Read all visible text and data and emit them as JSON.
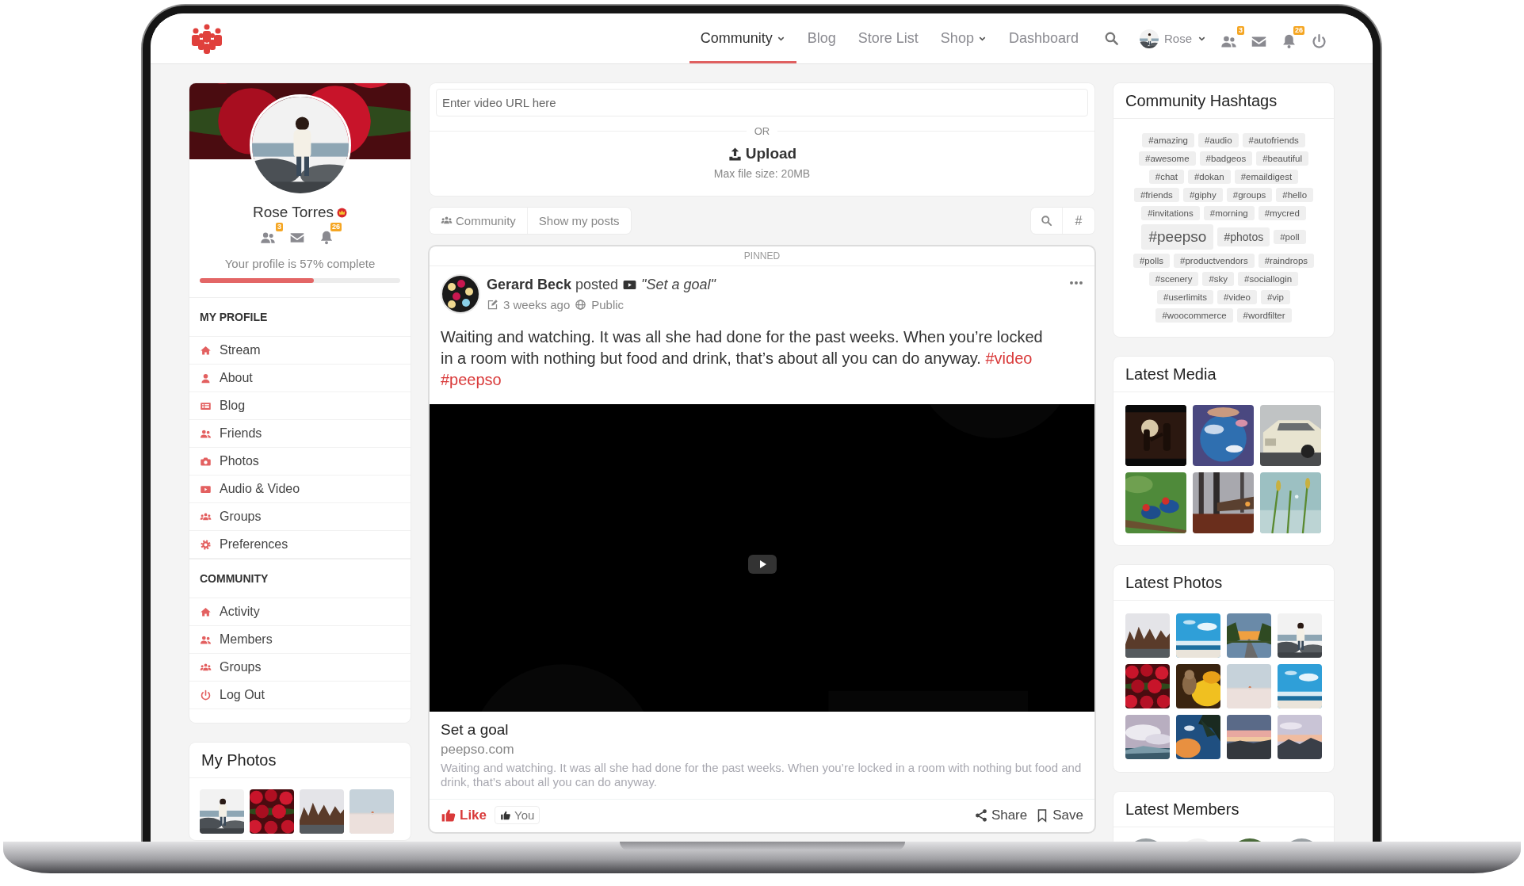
{
  "nav": {
    "items": [
      {
        "label": "Community",
        "selected": true,
        "dropdown": true
      },
      {
        "label": "Blog",
        "selected": false,
        "dropdown": false
      },
      {
        "label": "Store List",
        "selected": false,
        "dropdown": false
      },
      {
        "label": "Shop",
        "selected": false,
        "dropdown": true
      },
      {
        "label": "Dashboard",
        "selected": false,
        "dropdown": false
      }
    ],
    "user": {
      "name": "Rose"
    },
    "notifications": [
      {
        "kind": "friends",
        "badge": "3"
      },
      {
        "kind": "mail"
      },
      {
        "kind": "bell",
        "badge": "26"
      }
    ]
  },
  "profile": {
    "name": "Rose Torres",
    "notifications": [
      {
        "kind": "friends",
        "badge": "3"
      },
      {
        "kind": "mail"
      },
      {
        "kind": "bell",
        "badge": "26"
      }
    ],
    "completion": "Your profile is 57% complete",
    "level": 0.57
  },
  "menu": [
    {
      "title": "MY PROFILE",
      "items": [
        {
          "label": "Stream",
          "kind": "home"
        },
        {
          "label": "About",
          "kind": "user"
        },
        {
          "label": "Blog",
          "kind": "list"
        },
        {
          "label": "Friends",
          "kind": "friends"
        },
        {
          "label": "Photos",
          "kind": "camera"
        },
        {
          "label": "Audio & Video",
          "kind": "video"
        },
        {
          "label": "Groups",
          "kind": "groups"
        },
        {
          "label": "Preferences",
          "kind": "gear"
        }
      ]
    },
    {
      "title": "COMMUNITY",
      "items": [
        {
          "label": "Activity",
          "kind": "home"
        },
        {
          "label": "Members",
          "kind": "friends"
        },
        {
          "label": "Groups",
          "kind": "groups"
        },
        {
          "label": "Log Out",
          "kind": "power"
        }
      ]
    }
  ],
  "my_photos": {
    "title": "My Photos"
  },
  "upload": {
    "placeholder": "Enter video URL here",
    "separator": "OR",
    "button": "Upload",
    "note": "Max file size: 20MB"
  },
  "filters": {
    "tabs": [
      {
        "label": "Community",
        "kind": "groups"
      },
      {
        "label": "Show my posts",
        "kind": "plain"
      }
    ],
    "hashtag_button": "#"
  },
  "post": {
    "pinned": "PINNED",
    "author": "Gerard Beck",
    "action": "posted",
    "title": "\"Set a goal\"",
    "time": "3 weeks ago",
    "privacy": "Public",
    "text": "Waiting and watching. It was all she had done for the past weeks. When you’re locked in a room with nothing but food and drink, that’s about all you can do anyway.",
    "hashtags": [
      "#video",
      "#peepso"
    ],
    "embed": {
      "title": "Set a goal",
      "site": "peepso.com",
      "description": "Waiting and watching. It was all she had done for the past weeks. When you’re locked in a room with nothing but food and drink, that’s about all you can do anyway."
    },
    "like": {
      "label": "Like",
      "liked": true
    },
    "likers": "You",
    "share": "Share",
    "save": "Save"
  },
  "hashtags": {
    "title": "Community Hashtags",
    "tags": [
      {
        "label": "#amazing",
        "kind": "small"
      },
      {
        "label": "#audio",
        "kind": "small"
      },
      {
        "label": "#autofriends",
        "kind": "small"
      },
      {
        "label": "#awesome",
        "kind": "small"
      },
      {
        "label": "#badgeos",
        "kind": "small"
      },
      {
        "label": "#beautiful",
        "kind": "small"
      },
      {
        "label": "#chat",
        "kind": "small"
      },
      {
        "label": "#dokan",
        "kind": "small"
      },
      {
        "label": "#emaildigest",
        "kind": "small"
      },
      {
        "label": "#friends",
        "kind": "small"
      },
      {
        "label": "#giphy",
        "kind": "small"
      },
      {
        "label": "#groups",
        "kind": "small"
      },
      {
        "label": "#hello",
        "kind": "small"
      },
      {
        "label": "#invitations",
        "kind": "small"
      },
      {
        "label": "#morning",
        "kind": "small"
      },
      {
        "label": "#mycred",
        "kind": "small"
      },
      {
        "label": "#peepso",
        "kind": "big"
      },
      {
        "label": "#photos",
        "kind": "mid"
      },
      {
        "label": "#poll",
        "kind": "small"
      },
      {
        "label": "#polls",
        "kind": "small"
      },
      {
        "label": "#productvendors",
        "kind": "small"
      },
      {
        "label": "#raindrops",
        "kind": "small"
      },
      {
        "label": "#scenery",
        "kind": "small"
      },
      {
        "label": "#sky",
        "kind": "small"
      },
      {
        "label": "#sociallogin",
        "kind": "small"
      },
      {
        "label": "#userlimits",
        "kind": "small"
      },
      {
        "label": "#video",
        "kind": "small"
      },
      {
        "label": "#vip",
        "kind": "small"
      },
      {
        "label": "#woocommerce",
        "kind": "small"
      },
      {
        "label": "#wordfilter",
        "kind": "small"
      }
    ]
  },
  "latest_media": {
    "title": "Latest Media"
  },
  "latest_photos": {
    "title": "Latest Photos"
  },
  "latest_members": {
    "title": "Latest Members"
  }
}
